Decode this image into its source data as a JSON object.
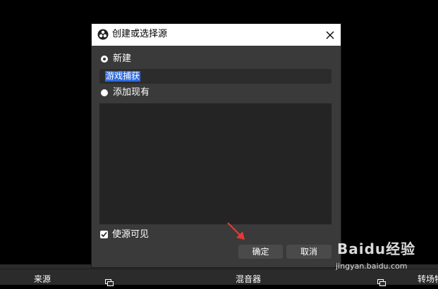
{
  "dialog": {
    "title": "创建或选择源",
    "new_label": "新建",
    "name_value": "游戏捕获",
    "add_existing_label": "添加现有",
    "visible_label": "使源可见",
    "ok_label": "确定",
    "cancel_label": "取消"
  },
  "bottom_panels": {
    "sources": "来源",
    "mixer": "混音器",
    "transitions": "转场特"
  },
  "watermark": {
    "brand": "Baidu经验",
    "url": "jingyan.baidu.com"
  },
  "colors": {
    "background": "#000000",
    "dialog_bg": "#3a3a3a",
    "selection": "#2f6ce0",
    "annotation_arrow": "#e53935"
  }
}
